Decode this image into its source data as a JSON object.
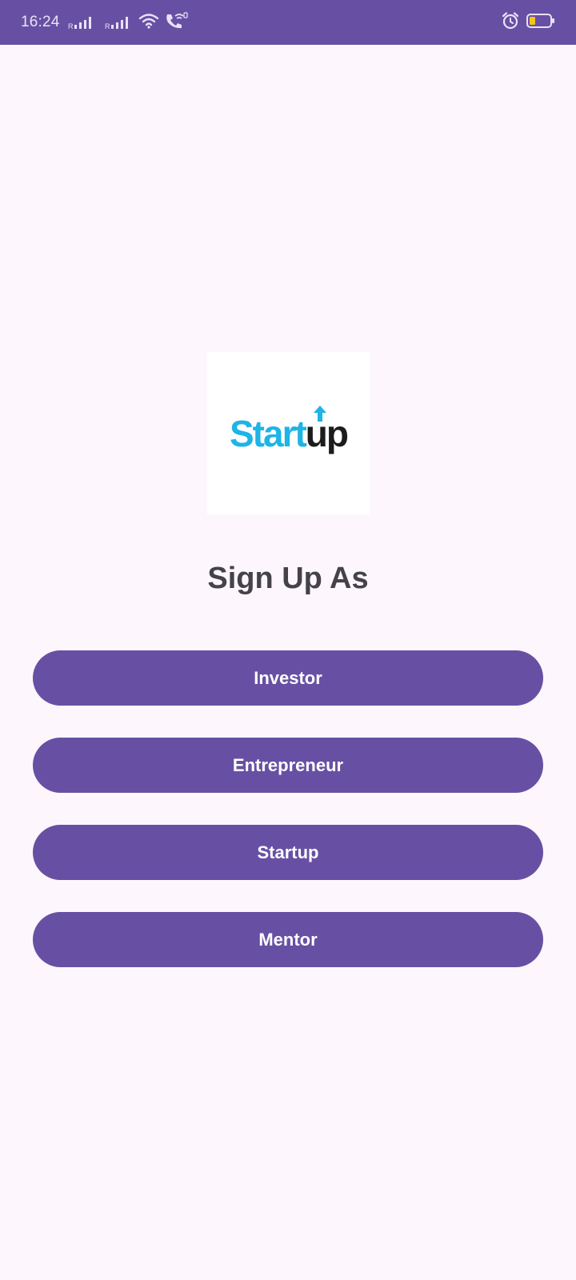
{
  "status_bar": {
    "time": "16:24",
    "sim1_tag": "R",
    "sim2_tag": "R",
    "icons": [
      "signal-icon",
      "signal-icon",
      "wifi-icon",
      "wifi-call-icon",
      "alarm-icon",
      "battery-icon"
    ],
    "battery_color": "#f5c518"
  },
  "logo": {
    "text_start": "Start",
    "text_up": "up",
    "alt": "Startup logo"
  },
  "title": "Sign Up As",
  "buttons": [
    {
      "label": "Investor"
    },
    {
      "label": "Entrepreneur"
    },
    {
      "label": "Startup"
    },
    {
      "label": "Mentor"
    }
  ],
  "colors": {
    "accent": "#6750a4",
    "background": "#fdf7fd",
    "title_text": "#45424a",
    "logo_blue": "#1eb4e6",
    "logo_dark": "#1c1c1c"
  }
}
